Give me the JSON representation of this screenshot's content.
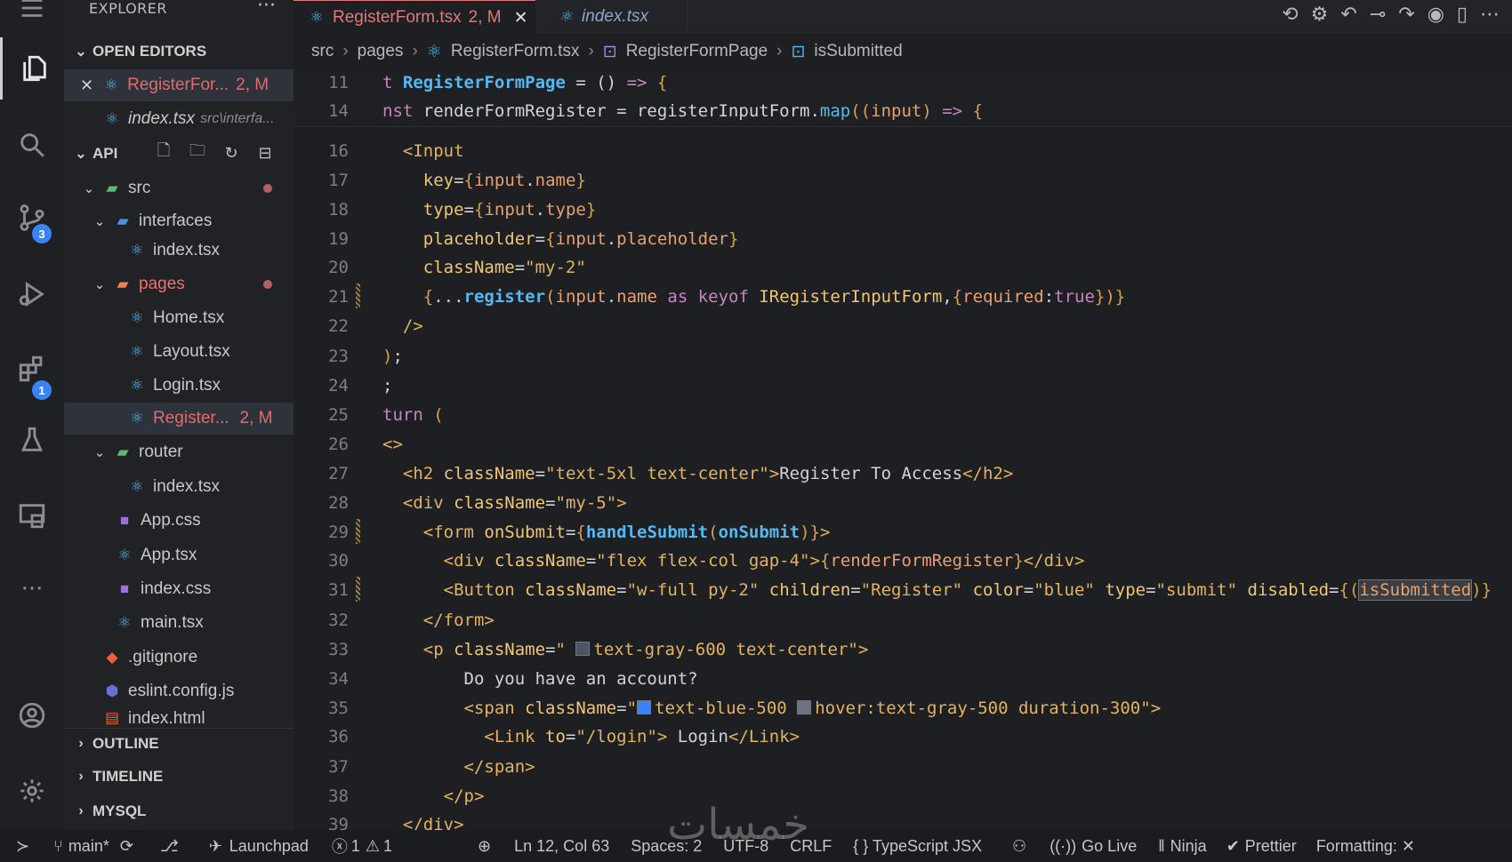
{
  "sidebar": {
    "title": "EXPLORER",
    "more": "···",
    "sections": {
      "open_editors": "OPEN EDITORS",
      "workspace": "API",
      "outline": "OUTLINE",
      "timeline": "TIMELINE",
      "mysql": "MYSQL"
    },
    "open_editors": [
      {
        "name": "RegisterFor...",
        "status": "2, M"
      },
      {
        "name": "index.tsx",
        "path": "src\\interfa..."
      }
    ],
    "tree": [
      {
        "name": "src"
      },
      {
        "name": "interfaces"
      },
      {
        "name": "index.tsx"
      },
      {
        "name": "pages"
      },
      {
        "name": "Home.tsx"
      },
      {
        "name": "Layout.tsx"
      },
      {
        "name": "Login.tsx"
      },
      {
        "name": "Register...",
        "status": "2, M"
      },
      {
        "name": "router"
      },
      {
        "name": "index.tsx"
      },
      {
        "name": "App.css"
      },
      {
        "name": "App.tsx"
      },
      {
        "name": "index.css"
      },
      {
        "name": "main.tsx"
      },
      {
        "name": ".gitignore"
      },
      {
        "name": "eslint.config.js"
      },
      {
        "name": "index.html"
      }
    ]
  },
  "activity_bar": {
    "icons": [
      "menu-icon",
      "files-icon",
      "search-icon",
      "source-control-icon",
      "run-debug-icon",
      "extensions-icon",
      "testing-icon",
      "remote-explorer-icon",
      "more-icon",
      "account-icon",
      "settings-icon"
    ],
    "source_control_badge": "3",
    "extensions_badge": "1"
  },
  "tabs": [
    {
      "label": "RegisterForm.tsx",
      "status": "2, M",
      "close": "✕"
    },
    {
      "label": "index.tsx"
    }
  ],
  "breadcrumb": [
    "src",
    "pages",
    "RegisterForm.tsx",
    "RegisterFormPage",
    "isSubmitted"
  ],
  "code": {
    "sticky": [
      {
        "ln": "11",
        "text": "t RegisterFormPage = () => {"
      },
      {
        "ln": "14",
        "text": "nst renderFormRegister = registerInputForm.map((input) => {"
      }
    ],
    "lines": [
      {
        "ln": "16"
      },
      {
        "ln": "17"
      },
      {
        "ln": "18"
      },
      {
        "ln": "19"
      },
      {
        "ln": "20"
      },
      {
        "ln": "21"
      },
      {
        "ln": "22"
      },
      {
        "ln": "23"
      },
      {
        "ln": "24"
      },
      {
        "ln": "25"
      },
      {
        "ln": "26"
      },
      {
        "ln": "27"
      },
      {
        "ln": "28"
      },
      {
        "ln": "29"
      },
      {
        "ln": "30"
      },
      {
        "ln": "31"
      },
      {
        "ln": "32"
      },
      {
        "ln": "33"
      },
      {
        "ln": "34"
      },
      {
        "ln": "35"
      },
      {
        "ln": "36"
      },
      {
        "ln": "37"
      },
      {
        "ln": "38"
      },
      {
        "ln": "39"
      }
    ]
  },
  "status_bar": {
    "remote": "≻",
    "branch": "main*",
    "launchpad": "Launchpad",
    "errors": "1",
    "warnings": "1",
    "cursor": "Ln 12, Col 63",
    "spaces": "Spaces: 2",
    "encoding": "UTF-8",
    "eol": "CRLF",
    "language": "{ } TypeScript JSX",
    "go_live": "Go Live",
    "ninja": "Ninja",
    "prettier": "Prettier",
    "formatting": "Formatting: ✕"
  },
  "colors": {
    "accent_modified": "#e07a7a",
    "react_icon": "#4fb7ea",
    "badge": "#3b82f6"
  }
}
